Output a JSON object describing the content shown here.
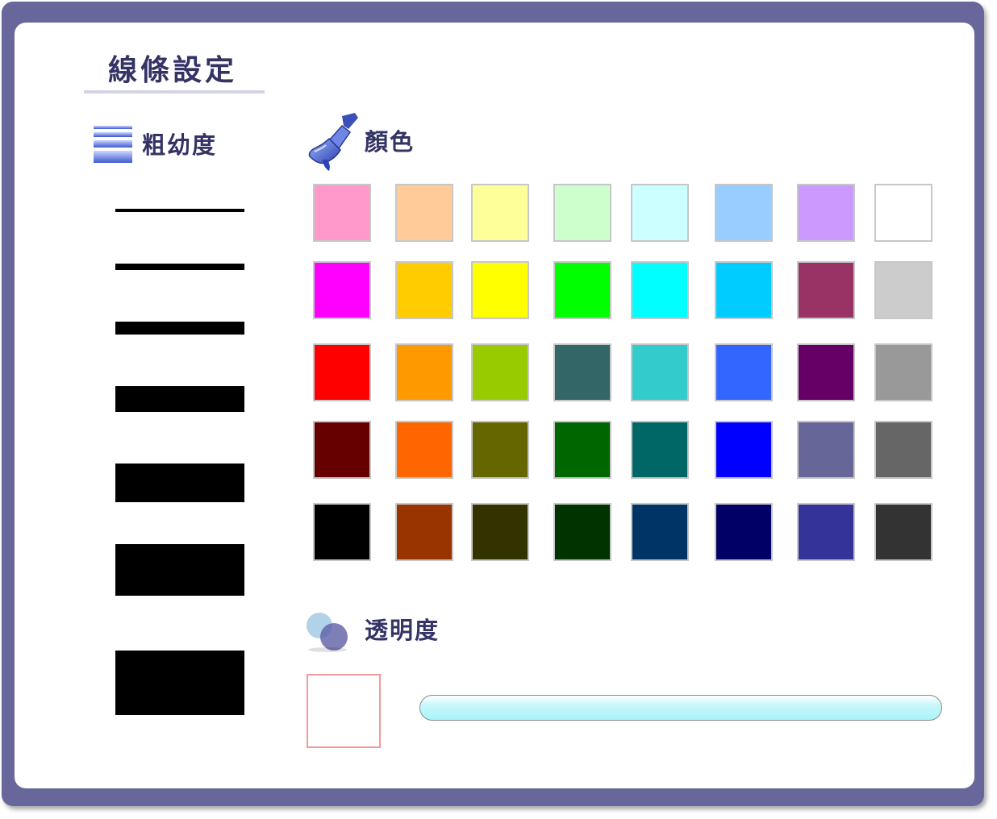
{
  "title": "線條設定",
  "thickness": {
    "label": "粗幼度",
    "icon": "line-thickness-icon",
    "options": [
      1,
      2,
      3,
      4,
      5,
      6,
      7
    ]
  },
  "color": {
    "label": "顏色",
    "icon": "paintbrush-icon",
    "palette": [
      [
        "#ff99cc",
        "#ffcc99",
        "#ffff99",
        "#ccffcc",
        "#ccffff",
        "#99ccff",
        "#cc99ff",
        "#ffffff"
      ],
      [
        "#ff00ff",
        "#ffcc00",
        "#ffff00",
        "#00ff00",
        "#00ffff",
        "#00ccff",
        "#993366",
        "#cccccc"
      ],
      [
        "#ff0000",
        "#ff9900",
        "#99cc00",
        "#336666",
        "#33cccc",
        "#3366ff",
        "#660066",
        "#999999"
      ],
      [
        "#660000",
        "#ff6600",
        "#666600",
        "#006600",
        "#006666",
        "#0000ff",
        "#666699",
        "#666666"
      ],
      [
        "#000000",
        "#993300",
        "#333300",
        "#003300",
        "#003366",
        "#000066",
        "#333399",
        "#333333"
      ]
    ]
  },
  "opacity": {
    "label": "透明度",
    "icon": "overlapping-circles-icon",
    "preview_color": "#ffffff"
  },
  "colors": {
    "frame": "#68679b",
    "label_text": "#333366",
    "preview_border": "#f29a9a",
    "slider_fill": "#a8f5fa"
  }
}
